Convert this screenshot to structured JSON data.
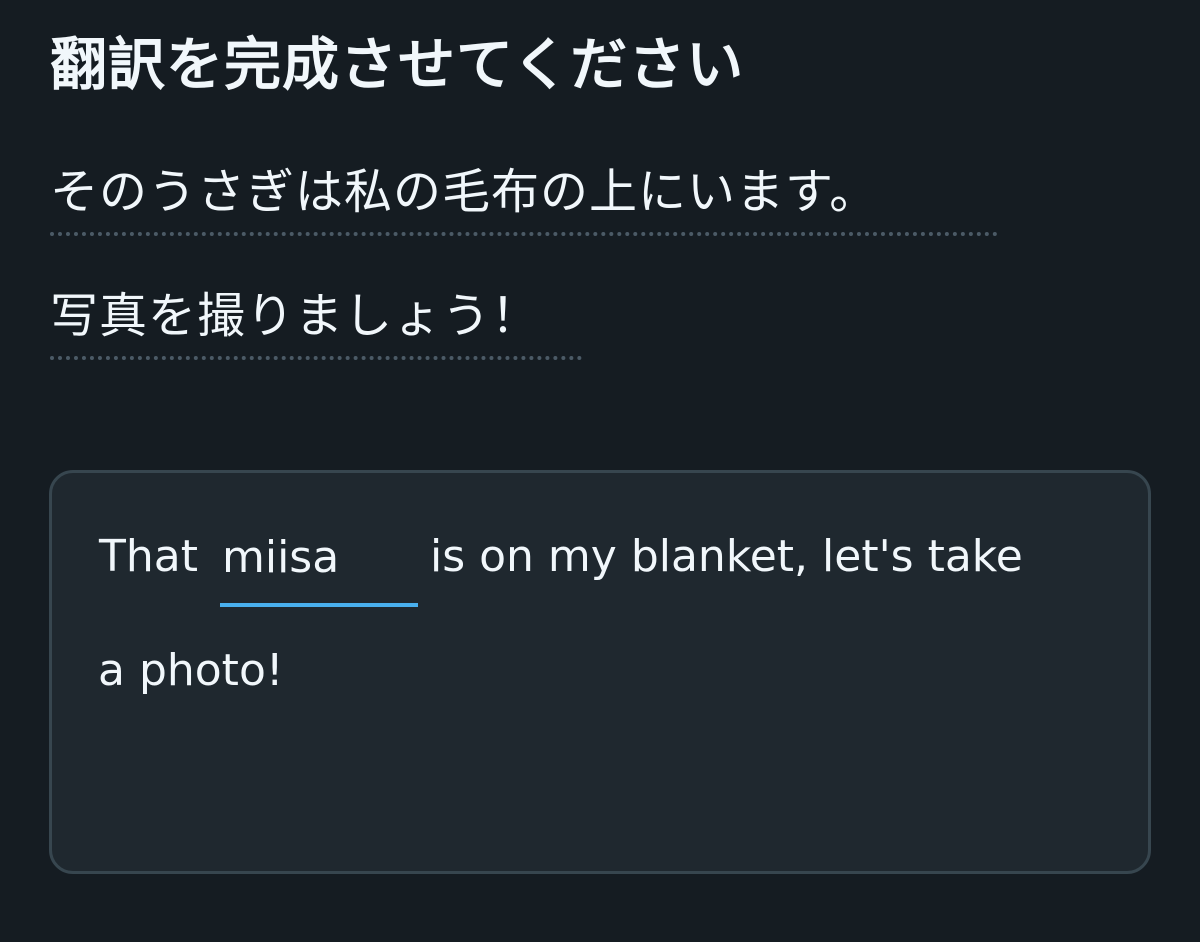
{
  "header": {
    "title": "翻訳を完成させてください"
  },
  "prompt": {
    "line1": "そのうさぎは私の毛布の上にいます。",
    "line2": "写真を撮りましょう！"
  },
  "answer": {
    "prefix": "That",
    "blank_value": "miisa",
    "suffix": "is on my blanket, let's take",
    "line2": "a photo!"
  },
  "colors": {
    "background": "#151c22",
    "text": "#f1f7fb",
    "box_background": "#1f282f",
    "box_border": "#37464f",
    "blank_underline": "#49b0ee",
    "dotted_underline": "#4b5a66"
  }
}
